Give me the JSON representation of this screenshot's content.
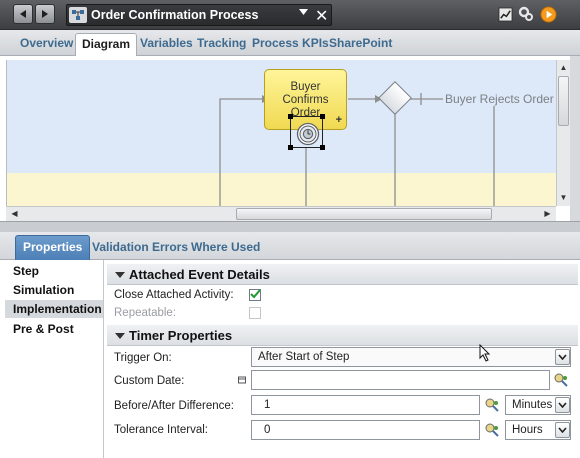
{
  "header": {
    "back_label": "Back",
    "forward_label": "Forward",
    "process_title": "Order Confirmation Process",
    "close_label": "Close"
  },
  "main_tabs": [
    {
      "label": "Overview",
      "active": false
    },
    {
      "label": "Diagram",
      "active": true
    },
    {
      "label": "Variables",
      "active": false
    },
    {
      "label": "Tracking",
      "active": false
    },
    {
      "label": "Process KPIs",
      "active": false
    },
    {
      "label": "SharePoint",
      "active": false
    }
  ],
  "diagram": {
    "task_label_lines": [
      "Buyer",
      "Confirms",
      "Order"
    ],
    "expand_marker": "+",
    "outcome_label": "Buyer Rejects Order",
    "colors": {
      "lane_blue": "#dde9f8",
      "lane_yellow": "#fbf6cf",
      "task_fill": "#f5e46a"
    }
  },
  "property_tabs": [
    {
      "label": "Properties",
      "active": true
    },
    {
      "label": "Validation Errors",
      "active": false
    },
    {
      "label": "Where Used",
      "active": false
    }
  ],
  "left_nav": [
    {
      "label": "Step",
      "active": false
    },
    {
      "label": "Simulation",
      "active": false
    },
    {
      "label": "Implementation",
      "active": true
    },
    {
      "label": "Pre & Post",
      "active": false
    }
  ],
  "attached_event": {
    "title": "Attached Event Details",
    "close_attached_label": "Close Attached Activity:",
    "close_attached_checked": true,
    "repeatable_label": "Repeatable:",
    "repeatable_checked": false
  },
  "timer": {
    "title": "Timer Properties",
    "trigger_label": "Trigger On:",
    "trigger_value": "After Start of Step",
    "custom_date_label": "Custom Date:",
    "custom_date_value": "",
    "difference_label": "Before/After Difference:",
    "difference_value": "1",
    "difference_unit": "Minutes",
    "tolerance_label": "Tolerance Interval:",
    "tolerance_value": "0",
    "tolerance_unit": "Hours"
  },
  "icons": {
    "back": "left-arrow-icon",
    "forward": "right-arrow-icon",
    "process": "process-icon",
    "chart": "chart-icon",
    "settings": "gear-icon",
    "run": "play-icon",
    "timer": "timer-event-icon",
    "variable_picker": "variable-picker-icon",
    "calendar": "calendar-link-icon"
  }
}
